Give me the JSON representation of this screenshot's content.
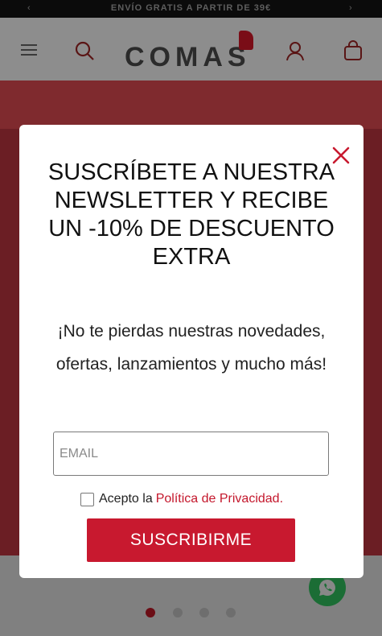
{
  "topbar": {
    "text": "ENVÍO GRATIS A PARTIR DE 39€"
  },
  "header": {
    "logo": "COMAS"
  },
  "modal": {
    "title": "SUSCRÍBETE A NUESTRA NEWSLETTER Y RECIBE UN -10% DE DESCUENTO EXTRA",
    "subtitle": "¡No te pierdas nuestras novedades, ofertas, lanzamientos y mucho más!",
    "email_placeholder": "EMAIL",
    "email_value": "",
    "consent_text": "Acepto la",
    "policy_link": "Política de Privacidad.",
    "submit_label": "SUSCRIBIRME"
  },
  "colors": {
    "accent": "#c8192f",
    "text": "#111111"
  },
  "carousel": {
    "slides": 4,
    "active_index": 0
  }
}
